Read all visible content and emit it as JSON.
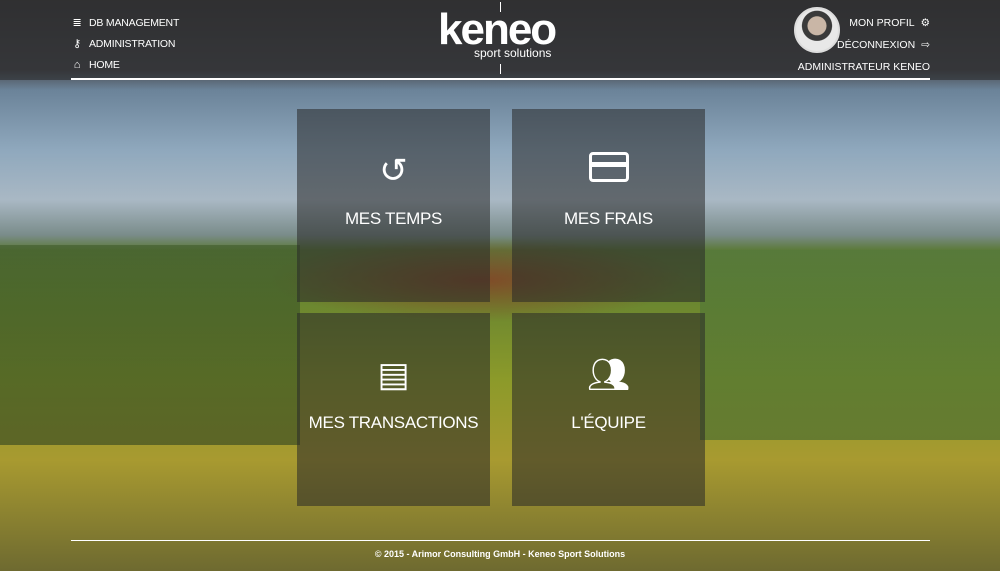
{
  "nav": {
    "items": [
      {
        "label": "DB MANAGEMENT",
        "icon": "database-icon"
      },
      {
        "label": "ADMINISTRATION",
        "icon": "key-icon"
      },
      {
        "label": "HOME",
        "icon": "home-icon"
      }
    ]
  },
  "logo": {
    "main": "keneo",
    "sub": "sport solutions"
  },
  "user": {
    "profile": "MON PROFIL",
    "logout": "DÉCONNEXION",
    "name": "ADMINISTRATEUR KENEO"
  },
  "tiles": [
    {
      "label": "MES TEMPS",
      "icon": "history-icon"
    },
    {
      "label": "MES FRAIS",
      "icon": "credit-card-icon"
    },
    {
      "label": "MES TRANSACTIONS",
      "icon": "document-icon"
    },
    {
      "label": "L'ÉQUIPE",
      "icon": "users-icon"
    }
  ],
  "footer": {
    "text": "© 2015 - Arimor Consulting GmbH - Keneo Sport Solutions"
  }
}
